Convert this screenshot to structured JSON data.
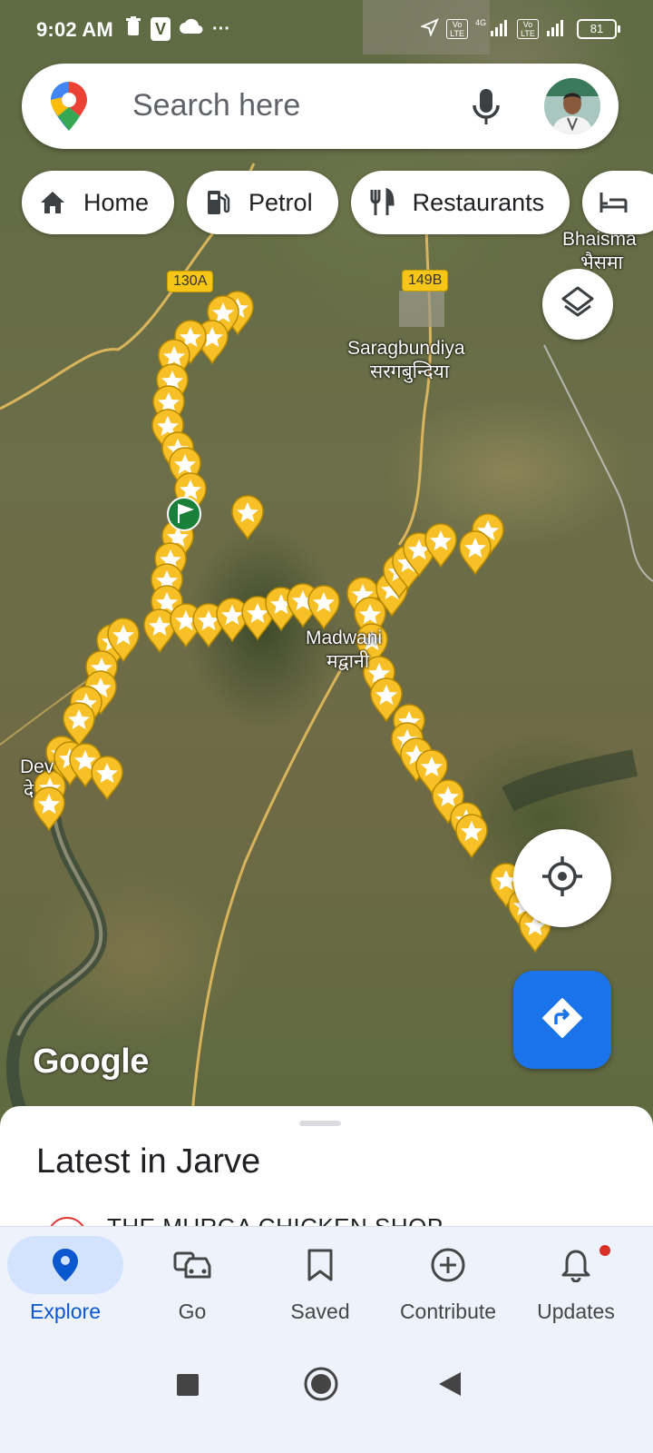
{
  "status_bar": {
    "time": "9:02 AM",
    "more": "···",
    "battery": "81",
    "icons": [
      "trash-icon",
      "v-app-icon",
      "cloud-icon",
      "location-arrow-icon",
      "volte-icon",
      "4g-signal-icon",
      "volte-icon",
      "signal-icon",
      "battery-icon"
    ],
    "v_label": "V",
    "lte1": "Vo LTE",
    "lte2": "Vo LTE",
    "net": "4G"
  },
  "search": {
    "placeholder": "Search here",
    "icons": [
      "google-maps-pin-icon",
      "microphone-icon",
      "avatar"
    ]
  },
  "chips": [
    {
      "label": "Home",
      "icon": "home-icon"
    },
    {
      "label": "Petrol",
      "icon": "fuel-pump-icon"
    },
    {
      "label": "Restaurants",
      "icon": "fork-knife-icon"
    },
    {
      "label": "",
      "icon": "bed-icon"
    }
  ],
  "map": {
    "labels": {
      "saragbundiya_en": "Saragbundiya",
      "saragbundiya_hi": "सरगबुन्दिया",
      "bhaisma_en": "Bhaisma",
      "bhaisma_hi": "भैसमा",
      "madwani_en": "Madwani",
      "madwani_hi": "मद्वानी",
      "dev_en": "Dev",
      "dev_hi": "दे"
    },
    "route_shields": [
      "130A",
      "149B"
    ],
    "watermark": "Google",
    "colors": {
      "marker": "#f6c026",
      "flag": "#188038",
      "roads": "#d9b45a"
    }
  },
  "sheet": {
    "title": "Latest in Jarve",
    "first_item": "THE MURGA CHICKEN SHOP"
  },
  "bottom_nav": [
    {
      "label": "Explore",
      "icon": "explore-pin-icon",
      "active": true
    },
    {
      "label": "Go",
      "icon": "car-icon",
      "active": false
    },
    {
      "label": "Saved",
      "icon": "bookmark-icon",
      "active": false
    },
    {
      "label": "Contribute",
      "icon": "add-circle-icon",
      "active": false
    },
    {
      "label": "Updates",
      "icon": "bell-icon",
      "active": false
    }
  ],
  "system_nav": [
    "recents-square-icon",
    "home-circle-icon",
    "back-triangle-icon"
  ],
  "accent": "#1a73e8"
}
